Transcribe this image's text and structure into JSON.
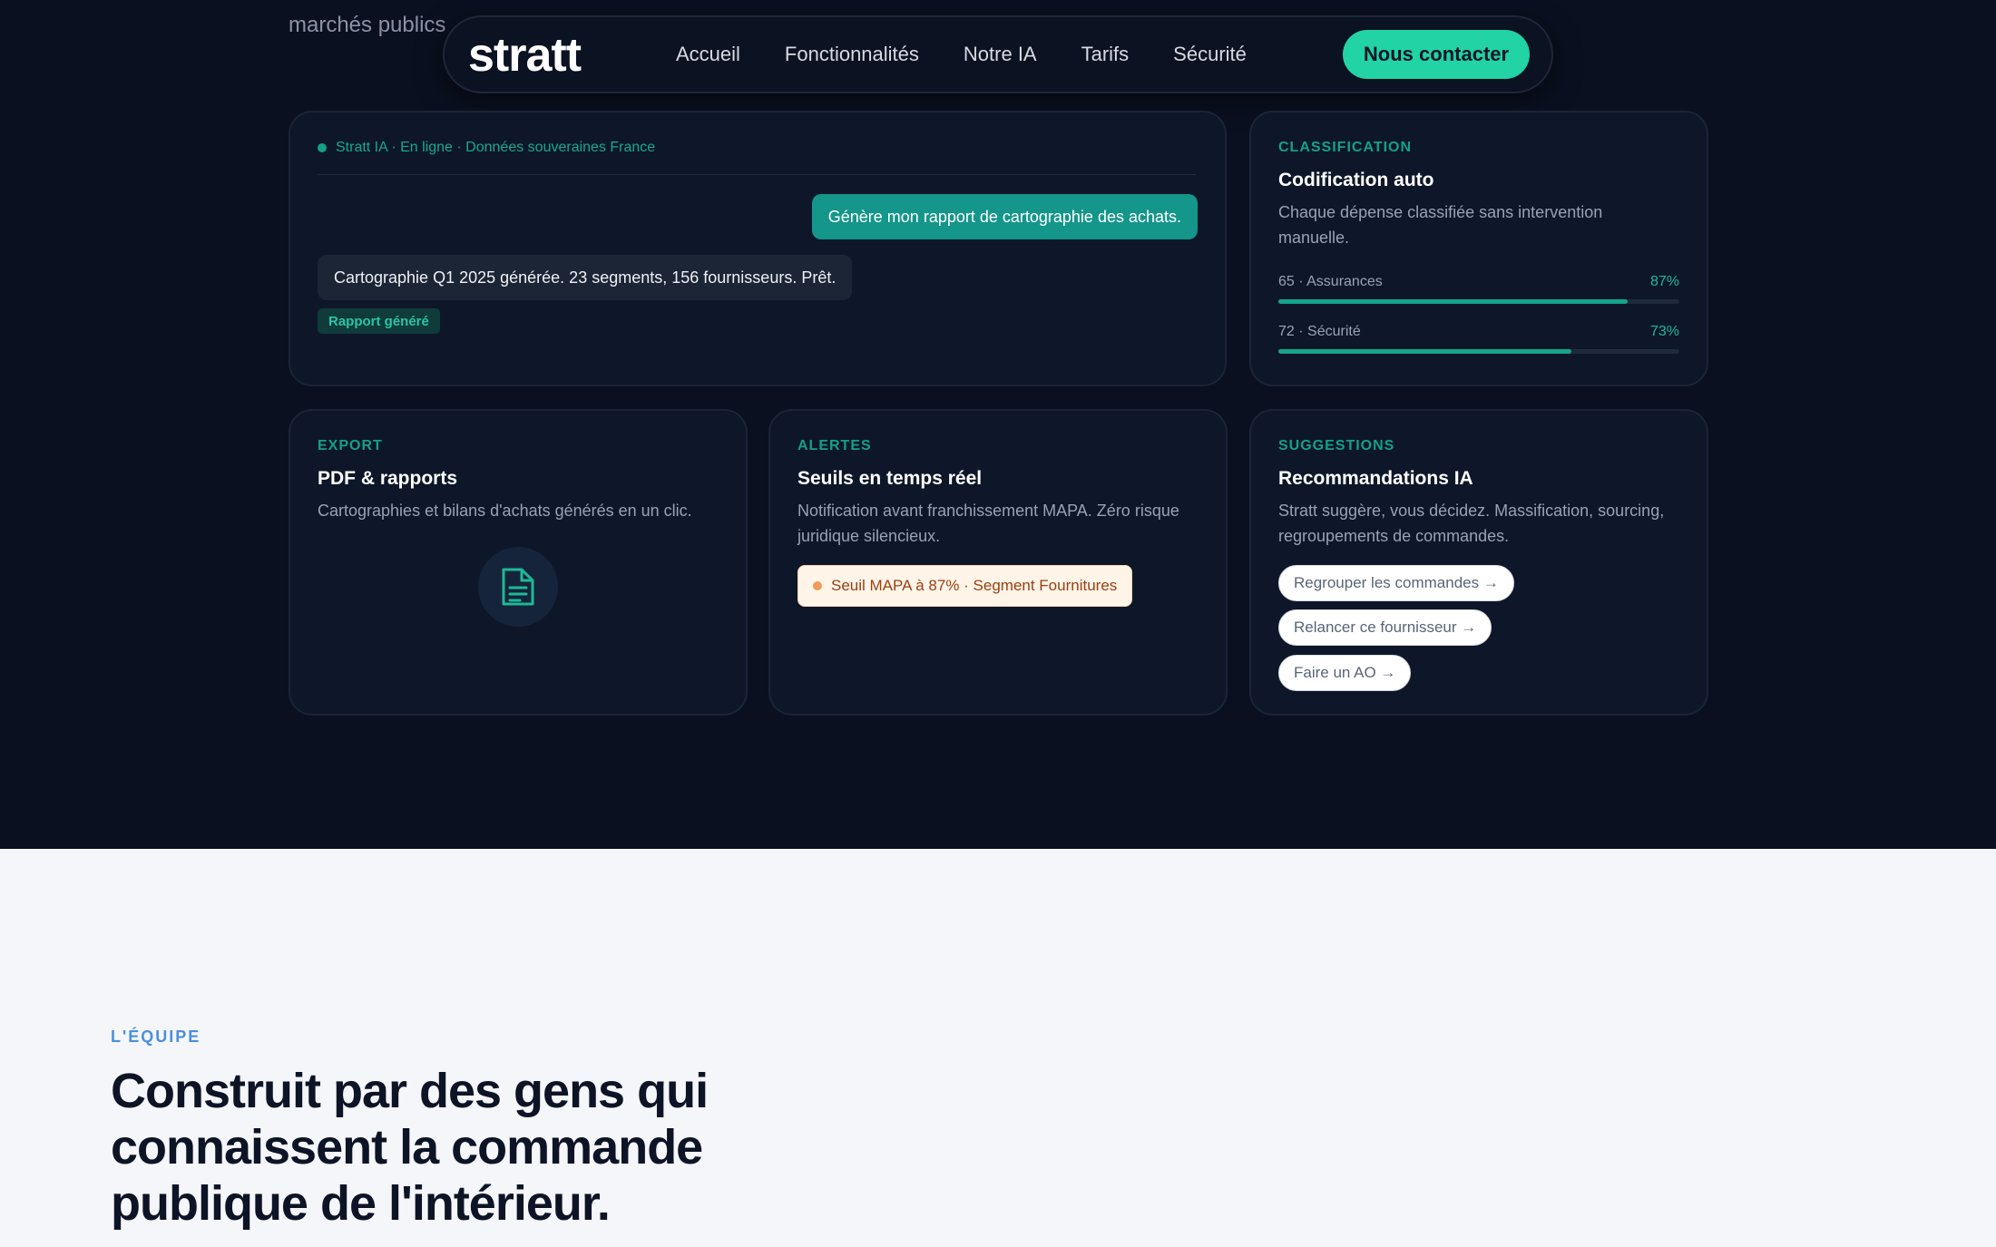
{
  "background_text": "marchés publics",
  "nav": {
    "logo": "stratt",
    "links": [
      "Accueil",
      "Fonctionnalités",
      "Notre IA",
      "Tarifs",
      "Sécurité"
    ],
    "cta": "Nous contacter"
  },
  "chat_card": {
    "status": "Stratt IA · En ligne · Données souveraines France",
    "user_message": "Génère mon rapport de cartographie des achats.",
    "bot_message": "Cartographie Q1 2025 générée. 23 segments, 156 fournisseurs. Prêt.",
    "badge": "Rapport généré"
  },
  "classification_card": {
    "eyebrow": "CLASSIFICATION",
    "title": "Codification auto",
    "description": "Chaque dépense classifiée sans intervention manuelle.",
    "bars": [
      {
        "label": "65 · Assurances",
        "pct_label": "87%",
        "value": 0.87
      },
      {
        "label": "72 · Sécurité",
        "pct_label": "73%",
        "value": 0.73
      }
    ]
  },
  "export_card": {
    "eyebrow": "EXPORT",
    "title": "PDF & rapports",
    "description": "Cartographies et bilans d'achats générés en un clic.",
    "icon": "document-icon"
  },
  "alerts_card": {
    "eyebrow": "ALERTES",
    "title": "Seuils en temps réel",
    "description": "Notification avant franchissement MAPA. Zéro risque juridique silencieux.",
    "alert": "Seuil MAPA à 87% · Segment Fournitures"
  },
  "suggestions_card": {
    "eyebrow": "SUGGESTIONS",
    "title": "Recommandations IA",
    "description": "Stratt suggère, vous décidez. Massification, sourcing, regroupements de commandes.",
    "chips": [
      "Regrouper les commandes →",
      "Relancer ce fournisseur →",
      "Faire un AO →"
    ]
  },
  "team": {
    "eyebrow": "L'ÉQUIPE",
    "title": "Construit par des gens qui connaissent la commande publique de l'intérieur."
  }
}
